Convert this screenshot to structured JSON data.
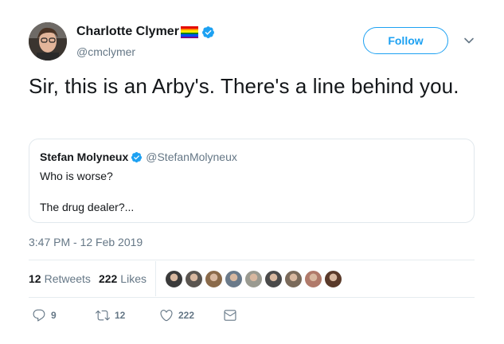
{
  "author": {
    "name": "Charlotte Clymer",
    "handle": "@cmclymer",
    "flag_colors": [
      "#e40303",
      "#ff8c00",
      "#ffed00",
      "#008026",
      "#004dff",
      "#750787"
    ],
    "verified_icon": "verified-badge-icon"
  },
  "follow_label": "Follow",
  "tweet_text": "Sir, this is an Arby's. There's a line behind you.",
  "quote": {
    "name": "Stefan Molyneux",
    "handle": "@StefanMolyneux",
    "line1": "Who is worse?",
    "line2": "The drug dealer?..."
  },
  "timestamp": "3:47 PM - 12 Feb 2019",
  "stats": {
    "retweets_count": "12",
    "retweets_label": "Retweets",
    "likes_count": "222",
    "likes_label": "Likes"
  },
  "liker_avatar_colors": [
    "#3a3a3a",
    "#5a5550",
    "#8a6a4a",
    "#6a7a8a",
    "#9a9a90",
    "#4a4a4a",
    "#7a6a5a",
    "#b07a6a",
    "#5a3a2a"
  ],
  "actions": {
    "reply_count": "9",
    "retweet_count": "12",
    "like_count": "222"
  },
  "colors": {
    "accent": "#1da1f2",
    "muted": "#657786",
    "text": "#14171a"
  }
}
